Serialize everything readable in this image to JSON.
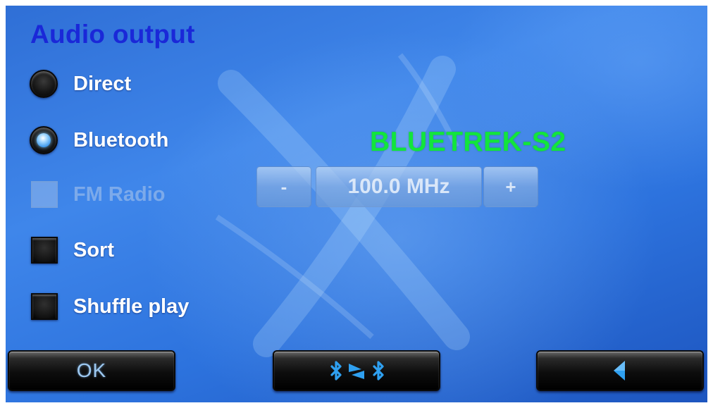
{
  "title": "Audio output",
  "options": {
    "direct": {
      "label": "Direct",
      "selected": false
    },
    "bluetooth": {
      "label": "Bluetooth",
      "selected": true
    },
    "fm_radio": {
      "label": "FM Radio",
      "enabled": false,
      "checked": false
    },
    "sort": {
      "label": "Sort",
      "checked": false
    },
    "shuffle": {
      "label": "Shuffle play",
      "checked": false
    }
  },
  "bluetooth_device": "BLUETREK-S2",
  "frequency": {
    "minus_label": "-",
    "value": "100.0 MHz",
    "plus_label": "+"
  },
  "buttons": {
    "ok_label": "OK",
    "bluetooth_switch_icon": "bluetooth-transfer-icon",
    "back_icon": "back-arrow-icon"
  },
  "colors": {
    "title": "#1a28d8",
    "device_name": "#12e53c",
    "radio_selected": "#2f8fe8",
    "button_icon": "#2fa0f0"
  }
}
